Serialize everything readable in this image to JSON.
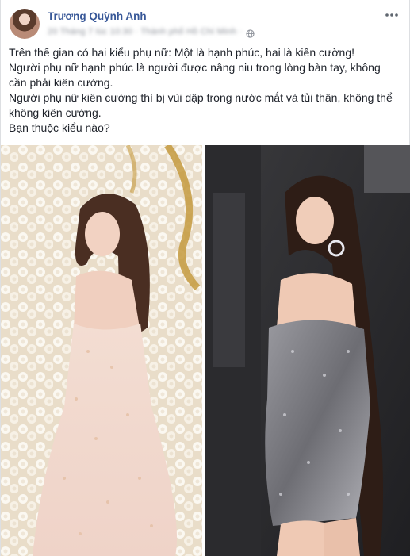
{
  "post": {
    "author": "Trương Quỳnh Anh",
    "meta_blurred": "20 Tháng 7 lúc 10:30 · Thành phố Hồ Chí Minh ·",
    "icons": {
      "privacy": "globe-icon",
      "menu": "more-horizontal-icon"
    },
    "lines": [
      "Trên thế gian có hai kiểu phụ nữ: Một là hạnh phúc, hai là kiên cường!",
      "Người phụ nữ hạnh phúc là người được nâng niu trong lòng bàn tay, không",
      "cần phải kiên cường.",
      "Người phụ nữ kiên cường thì bị vùi dập trong nước mắt và tủi thân, không thể",
      "không kiên cường.",
      "Bạn thuộc kiểu nào?"
    ],
    "photos": [
      {
        "alt": "woman in pink sparkly gown before white flower wall",
        "accent": "#f5e6dc"
      },
      {
        "alt": "woman in silver sequin dress",
        "accent": "#6e6e72"
      }
    ]
  },
  "colors": {
    "link": "#385898",
    "meta": "#90949c",
    "text": "#1d2129"
  }
}
